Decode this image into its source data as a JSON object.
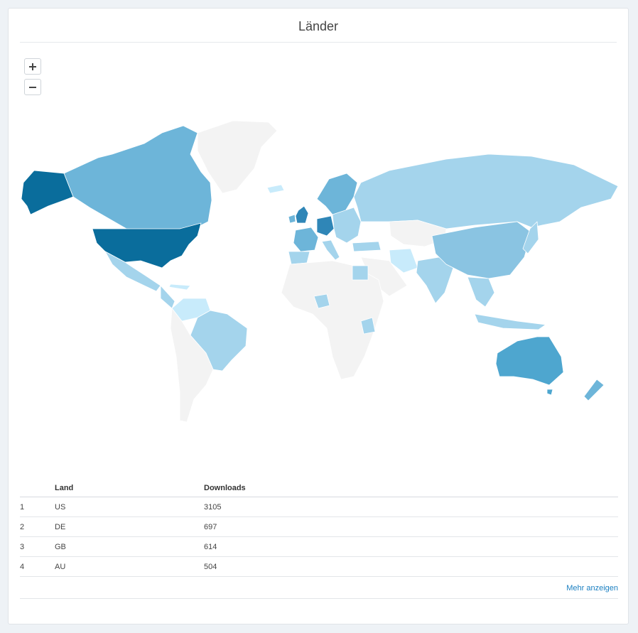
{
  "panel": {
    "title": "Länder"
  },
  "zoom": {
    "in_label": "+",
    "out_label": "−"
  },
  "legend_colors": {
    "highest": "#0a6d9c",
    "high": "#4ea6cf",
    "medium": "#6db5d9",
    "low": "#a4d4ec",
    "lowest": "#c8ebfb",
    "no_data": "#f3f3f3"
  },
  "table": {
    "columns": [
      "",
      "Land",
      "Downloads"
    ],
    "rows": [
      {
        "rank": "1",
        "country": "US",
        "downloads": "3105"
      },
      {
        "rank": "2",
        "country": "DE",
        "downloads": "697"
      },
      {
        "rank": "3",
        "country": "GB",
        "downloads": "614"
      },
      {
        "rank": "4",
        "country": "AU",
        "downloads": "504"
      }
    ],
    "more_label": "Mehr anzeigen"
  }
}
